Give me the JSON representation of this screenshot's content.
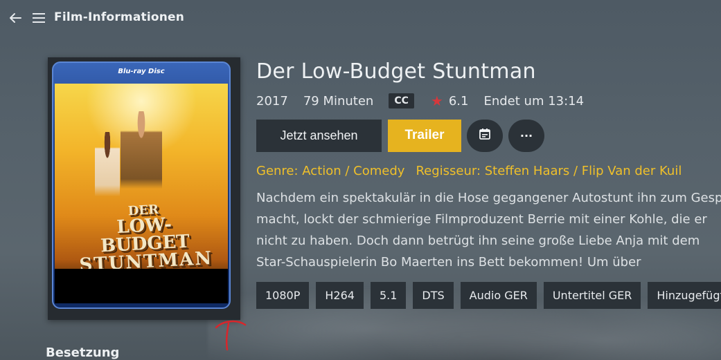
{
  "header": {
    "title": "Film-Informationen",
    "back_icon": "arrow-left-icon",
    "menu_icon": "hamburger-menu-icon"
  },
  "poster": {
    "case_label": "Blu-ray Disc",
    "cover_title_line1": "DER",
    "cover_title_line2": "LOW-BUDGET",
    "cover_title_line3": "STUNTMAN"
  },
  "movie": {
    "title": "Der Low-Budget Stuntman",
    "year": "2017",
    "runtime": "79 Minuten",
    "cc_badge": "CC",
    "rating": "6.1",
    "ends_at": "Endet um 13:14",
    "genre": "Genre: Action / Comedy",
    "director": "Regisseur: Steffen Haars / Flip Van der Kuil",
    "overview_lines": [
      "Nachdem ein spektakulär in die Hose gegangener Autostunt ihn zum Gespött",
      "macht, lockt der schmierige Filmproduzent Berrie mit einer Kohle, die er",
      "nicht zu haben. Doch dann betrügt ihn seine große Liebe Anja mit dem",
      "Star-Schauspielerin Bo Maerten ins Bett bekommen! Um über"
    ]
  },
  "actions": {
    "play_label": "Jetzt ansehen",
    "trailer_label": "Trailer",
    "calendar_icon": "calendar-icon",
    "more_label": "···"
  },
  "tags": [
    "1080P",
    "H264",
    "5.1",
    "DTS",
    "Audio GER",
    "Untertitel GER",
    "Hinzugefügt"
  ],
  "sections": {
    "cast_title": "Besetzung"
  },
  "colors": {
    "accent": "#e6b31f",
    "genre_text": "#f0c02a",
    "rating_star": "#d6383c",
    "button_bg": "#2b3238"
  }
}
